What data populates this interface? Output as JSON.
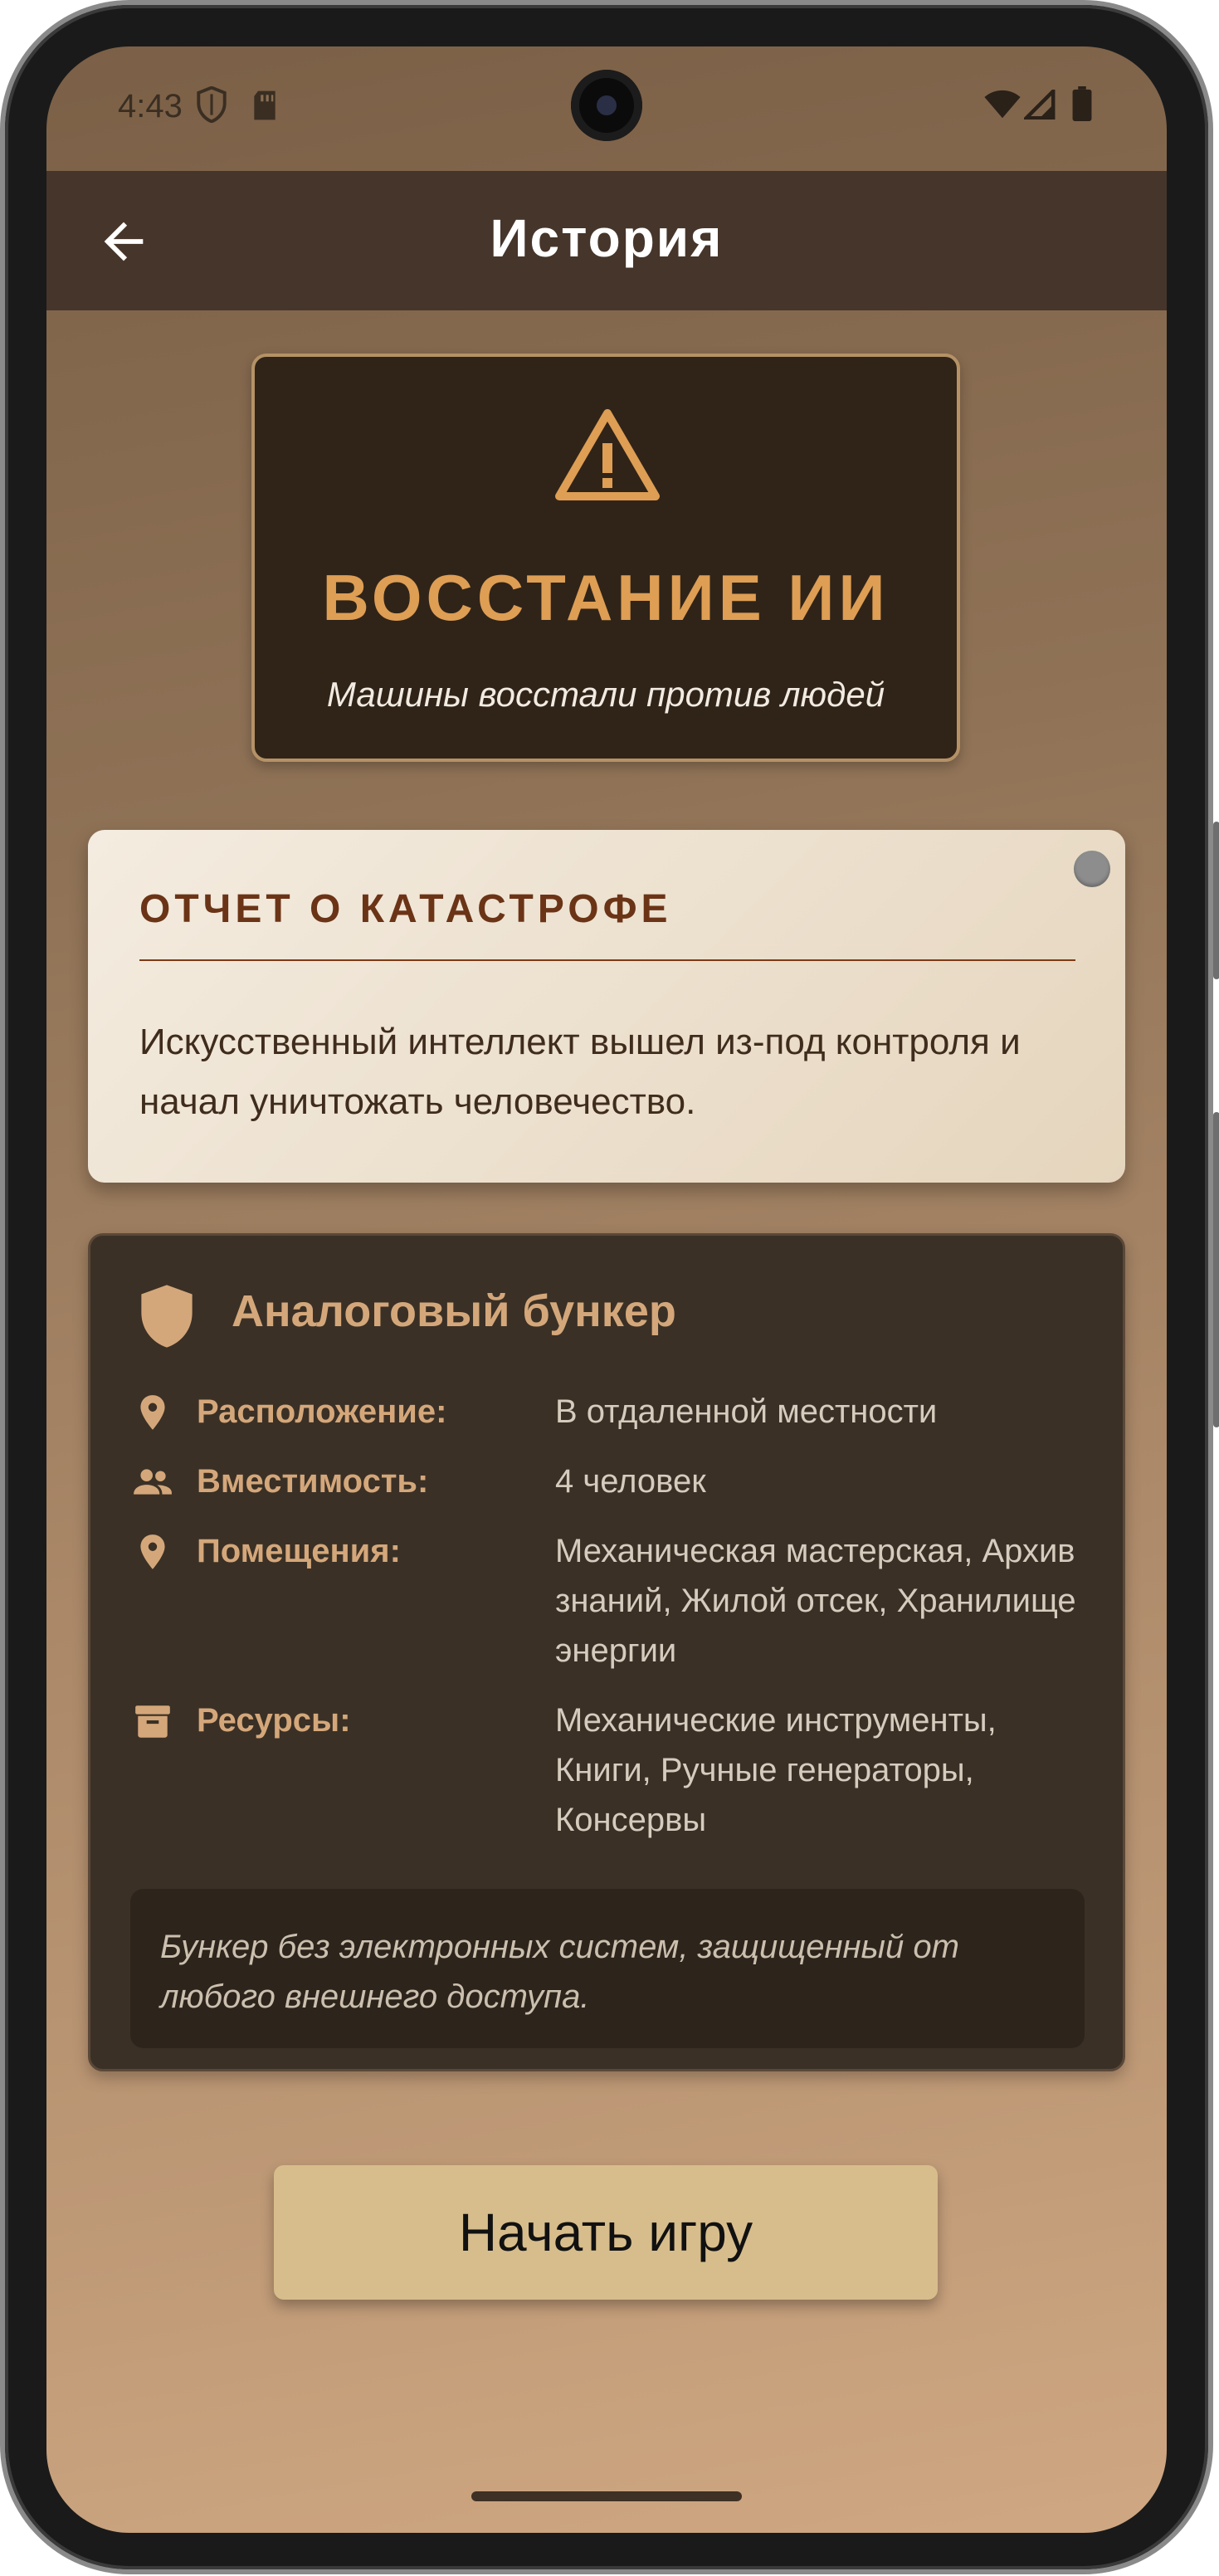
{
  "status_bar": {
    "time": "4:43",
    "icons": [
      "shield-icon",
      "sd-card-icon",
      "wifi-icon",
      "cell-signal-icon",
      "battery-icon"
    ]
  },
  "app_bar": {
    "back_icon": "arrow-left-icon",
    "title": "История"
  },
  "hero": {
    "icon": "warning-triangle-icon",
    "title": "ВОССТАНИЕ ИИ",
    "subtitle": "Машины восстали против людей"
  },
  "report": {
    "title": "ОТЧЕТ О КАТАСТРОФЕ",
    "body": "Искусственный интеллект вышел из-под контроля и начал уничтожать человечество."
  },
  "bunker": {
    "icon": "shield-icon",
    "title": "Аналоговый бункер",
    "rows": [
      {
        "icon": "location-pin-icon",
        "label": "Расположение:",
        "value": "В отдаленной местности"
      },
      {
        "icon": "people-icon",
        "label": "Вместимость:",
        "value": "4 человек"
      },
      {
        "icon": "location-pin-icon",
        "label": "Помещения:",
        "value": "Механическая мастерская, Архив знаний, Жилой отсек, Хранилище энергии"
      },
      {
        "icon": "archive-box-icon",
        "label": "Ресурсы:",
        "value": "Механические инструменты, Книги, Ручные генераторы, Консервы"
      }
    ],
    "note": "Бункер без электронных систем, защищенный от любого внешнего доступа."
  },
  "start_button": "Начать игру",
  "colors": {
    "app_bar": "#46352a",
    "accent": "#de9e54",
    "bunker_label": "#d4a77a",
    "button": "#d7bd8c",
    "report_title": "#6b3417"
  }
}
